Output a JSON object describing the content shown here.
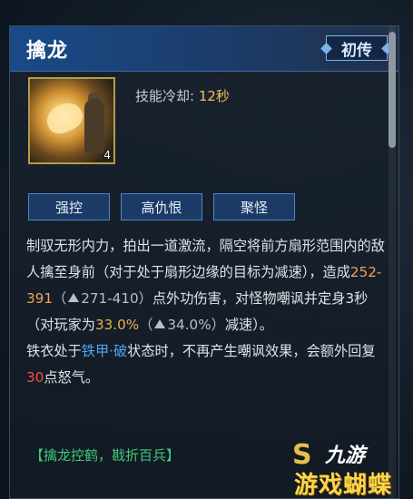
{
  "skill": {
    "name": "擒龙",
    "rank": "初传",
    "level": "4",
    "cooldown_label": "技能冷却:",
    "cooldown_value": "12秒"
  },
  "tags": [
    "强控",
    "高仇恨",
    "聚怪"
  ],
  "description": {
    "p1": "制驭无形内力，拍出一道激流，隔空将前方扇形范围内的敌人擒至身前（对于处于扇形边缘的目标为减速），造成",
    "damage": "252-391",
    "paren_open": "（",
    "damage_up": "271-410",
    "paren_close": "）",
    "p2": "点外功伤害，对怪物嘲讽并定身3秒（对玩家为",
    "slow": "33.0%",
    "paren_open2": "（",
    "slow_up": "34.0%",
    "paren_close2": "）",
    "p3": "减速）。",
    "p4": "铁衣处于",
    "state": "铁甲·破",
    "p5": "状态时，不再产生嘲讽效果，会额外回复",
    "rage": "30",
    "p6": "点怒气。"
  },
  "quote": "【擒龙控鹤，戡折百兵】",
  "watermark": {
    "icon": "S",
    "top": "九游",
    "bottom": "游戏蝴蝶"
  },
  "colors": {
    "header": "#1a4a88",
    "damage": "#f0a25a",
    "highlight_blue": "#4fa8f0",
    "rage_red": "#ff4a3d",
    "quote_green": "#3fc97a",
    "cooldown_gold": "#f2c15a"
  }
}
